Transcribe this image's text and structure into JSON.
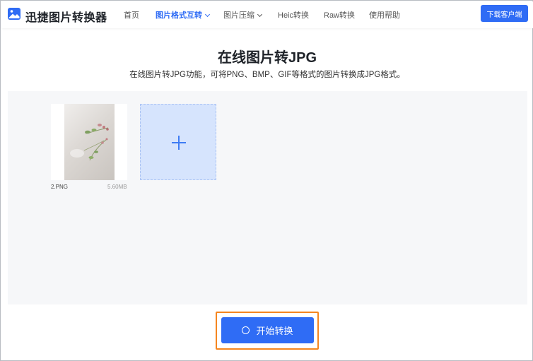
{
  "header": {
    "brand": "迅捷图片转换器",
    "nav": [
      {
        "label": "首页"
      },
      {
        "label": "图片格式互转"
      },
      {
        "label": "图片压缩"
      },
      {
        "label": "Heic转换"
      },
      {
        "label": "Raw转换"
      },
      {
        "label": "使用帮助"
      }
    ],
    "download_label": "下载客户端"
  },
  "main": {
    "title": "在线图片转JPG",
    "subtitle": "在线图片转JPG功能，可将PNG、BMP、GIF等格式的图片转换成JPG格式。"
  },
  "files": [
    {
      "name": "2.PNG",
      "size": "5.60MB"
    }
  ],
  "actions": {
    "start_label": "开始转换"
  },
  "colors": {
    "accent": "#2f6cf5",
    "highlight": "#f5861f",
    "add_box": "#d6e4fd"
  },
  "icons": {
    "logo": "image-icon",
    "add": "plus-icon",
    "loading": "spinner-icon"
  }
}
